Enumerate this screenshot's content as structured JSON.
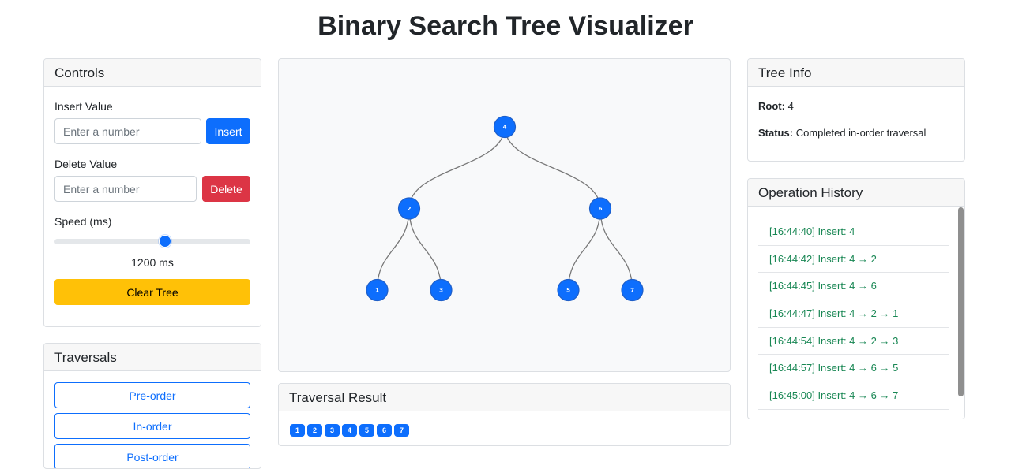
{
  "title": "Binary Search Tree Visualizer",
  "controls": {
    "header": "Controls",
    "insert_label": "Insert Value",
    "insert_placeholder": "Enter a number",
    "insert_button": "Insert",
    "delete_label": "Delete Value",
    "delete_placeholder": "Enter a number",
    "delete_button": "Delete",
    "speed_label": "Speed (ms)",
    "speed_value_text": "1200 ms",
    "speed_fraction": 0.57,
    "clear_button": "Clear Tree"
  },
  "traversals": {
    "header": "Traversals",
    "buttons": [
      "Pre-order",
      "In-order",
      "Post-order"
    ]
  },
  "tree": {
    "nodes": [
      {
        "value": "4",
        "parent": null
      },
      {
        "value": "2",
        "parent": "4"
      },
      {
        "value": "6",
        "parent": "4"
      },
      {
        "value": "1",
        "parent": "2"
      },
      {
        "value": "3",
        "parent": "2"
      },
      {
        "value": "5",
        "parent": "6"
      },
      {
        "value": "7",
        "parent": "6"
      }
    ]
  },
  "traversal_result": {
    "header": "Traversal Result",
    "values": [
      "1",
      "2",
      "3",
      "4",
      "5",
      "6",
      "7"
    ]
  },
  "tree_info": {
    "header": "Tree Info",
    "root_label": "Root:",
    "root_value": "4",
    "status_label": "Status:",
    "status_value": "Completed in-order traversal"
  },
  "history": {
    "header": "Operation History",
    "items": [
      "[16:44:40] Insert: 4",
      "[16:44:42] Insert: 4 → 2",
      "[16:44:45] Insert: 4 → 6",
      "[16:44:47] Insert: 4 → 2 → 1",
      "[16:44:54] Insert: 4 → 2 → 3",
      "[16:44:57] Insert: 4 → 6 → 5",
      "[16:45:00] Insert: 4 → 6 → 7"
    ]
  },
  "colors": {
    "primary": "#0d6efd",
    "danger": "#dc3545",
    "warning": "#ffc107",
    "success_text": "#198754"
  }
}
